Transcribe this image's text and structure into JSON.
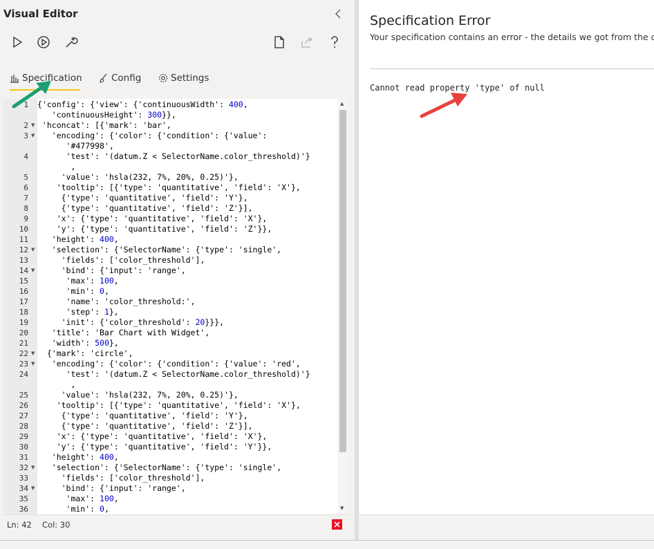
{
  "left_pane": {
    "title": "Visual Editor",
    "toolbar": {
      "run": "play-icon",
      "auto_run": "auto-run-icon",
      "tools": "wrench-icon",
      "new": "new-document-icon",
      "share": "share-icon",
      "help": "help-icon"
    },
    "tabs": [
      {
        "label": "Specification",
        "icon": "bar-chart-icon",
        "active": true
      },
      {
        "label": "Config",
        "icon": "brush-icon",
        "active": false
      },
      {
        "label": "Settings",
        "icon": "gear-icon",
        "active": false
      }
    ],
    "editor": {
      "lines": [
        {
          "n": "1",
          "fold": false,
          "text": "{'config': {'view': {'continuousWidth': 400,"
        },
        {
          "n": "",
          "fold": false,
          "text": "   'continuousHeight': 300}},"
        },
        {
          "n": "2",
          "fold": true,
          "text": " 'hconcat': [{'mark': 'bar',"
        },
        {
          "n": "3",
          "fold": true,
          "text": "   'encoding': {'color': {'condition': {'value':"
        },
        {
          "n": "",
          "fold": false,
          "text": "      '#477998',"
        },
        {
          "n": "4",
          "fold": false,
          "text": "      'test': '(datum.Z < SelectorName.color_threshold)'}"
        },
        {
          "n": "",
          "fold": false,
          "text": "       ,"
        },
        {
          "n": "5",
          "fold": false,
          "text": "     'value': 'hsla(232, 7%, 20%, 0.25)'},"
        },
        {
          "n": "6",
          "fold": false,
          "text": "    'tooltip': [{'type': 'quantitative', 'field': 'X'},"
        },
        {
          "n": "7",
          "fold": false,
          "text": "     {'type': 'quantitative', 'field': 'Y'},"
        },
        {
          "n": "8",
          "fold": false,
          "text": "     {'type': 'quantitative', 'field': 'Z'}],"
        },
        {
          "n": "9",
          "fold": false,
          "text": "    'x': {'type': 'quantitative', 'field': 'X'},"
        },
        {
          "n": "10",
          "fold": false,
          "text": "    'y': {'type': 'quantitative', 'field': 'Z'}},"
        },
        {
          "n": "11",
          "fold": false,
          "text": "   'height': 400,"
        },
        {
          "n": "12",
          "fold": true,
          "text": "   'selection': {'SelectorName': {'type': 'single',"
        },
        {
          "n": "13",
          "fold": false,
          "text": "     'fields': ['color_threshold'],"
        },
        {
          "n": "14",
          "fold": true,
          "text": "     'bind': {'input': 'range',"
        },
        {
          "n": "15",
          "fold": false,
          "text": "      'max': 100,"
        },
        {
          "n": "16",
          "fold": false,
          "text": "      'min': 0,"
        },
        {
          "n": "17",
          "fold": false,
          "text": "      'name': 'color_threshold:',"
        },
        {
          "n": "18",
          "fold": false,
          "text": "      'step': 1},"
        },
        {
          "n": "19",
          "fold": false,
          "text": "     'init': {'color_threshold': 20}}},"
        },
        {
          "n": "20",
          "fold": false,
          "text": "   'title': 'Bar Chart with Widget',"
        },
        {
          "n": "21",
          "fold": false,
          "text": "   'width': 500},"
        },
        {
          "n": "22",
          "fold": true,
          "text": "  {'mark': 'circle',"
        },
        {
          "n": "23",
          "fold": true,
          "text": "   'encoding': {'color': {'condition': {'value': 'red',"
        },
        {
          "n": "24",
          "fold": false,
          "text": "      'test': '(datum.Z < SelectorName.color_threshold)'}"
        },
        {
          "n": "",
          "fold": false,
          "text": "       ,"
        },
        {
          "n": "25",
          "fold": false,
          "text": "     'value': 'hsla(232, 7%, 20%, 0.25)'},"
        },
        {
          "n": "26",
          "fold": false,
          "text": "    'tooltip': [{'type': 'quantitative', 'field': 'X'},"
        },
        {
          "n": "27",
          "fold": false,
          "text": "     {'type': 'quantitative', 'field': 'Y'},"
        },
        {
          "n": "28",
          "fold": false,
          "text": "     {'type': 'quantitative', 'field': 'Z'}],"
        },
        {
          "n": "29",
          "fold": false,
          "text": "    'x': {'type': 'quantitative', 'field': 'X'},"
        },
        {
          "n": "30",
          "fold": false,
          "text": "    'y': {'type': 'quantitative', 'field': 'Y'}},"
        },
        {
          "n": "31",
          "fold": false,
          "text": "   'height': 400,"
        },
        {
          "n": "32",
          "fold": true,
          "text": "   'selection': {'SelectorName': {'type': 'single',"
        },
        {
          "n": "33",
          "fold": false,
          "text": "     'fields': ['color_threshold'],"
        },
        {
          "n": "34",
          "fold": true,
          "text": "     'bind': {'input': 'range',"
        },
        {
          "n": "35",
          "fold": false,
          "text": "      'max': 100,"
        },
        {
          "n": "36",
          "fold": false,
          "text": "      'min': 0,"
        }
      ]
    },
    "status": {
      "line": "Ln: 42",
      "col": "Col: 30"
    }
  },
  "right_pane": {
    "title": "Specification Error",
    "subtitle": "Your specification contains an error - the details we got from the co",
    "message": "Cannot read property 'type' of null"
  },
  "colors": {
    "accent_underline": "#f2c811",
    "error_red": "#e81123",
    "annotation_green": "#1a9e73",
    "annotation_red": "#e8413c",
    "number_blue": "#0000cd"
  }
}
